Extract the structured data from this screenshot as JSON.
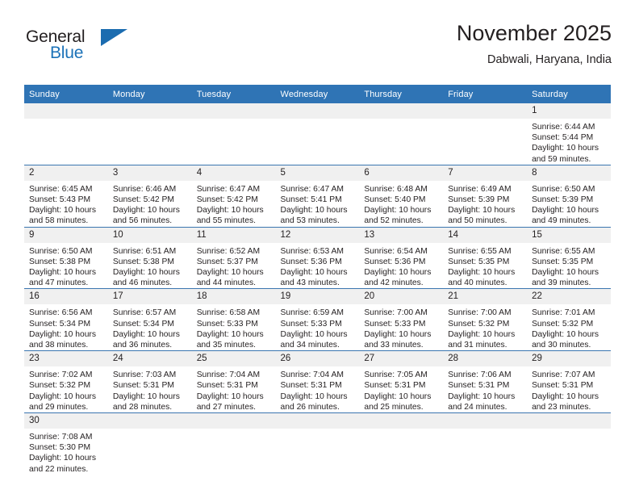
{
  "brand": {
    "word_one": "General",
    "word_two": "Blue",
    "flag_icon": "triangle-flag-icon",
    "accent_color": "#1b6cb0"
  },
  "header": {
    "title": "November 2025",
    "subtitle": "Dabwali, Haryana, India"
  },
  "theme": {
    "header_bg": "#2f74b5",
    "daynum_bg": "#f0f0f0",
    "row_divider": "#3b76b0",
    "text": "#231f20"
  },
  "weekday_headers": [
    "Sunday",
    "Monday",
    "Tuesday",
    "Wednesday",
    "Thursday",
    "Friday",
    "Saturday"
  ],
  "weeks": [
    [
      {
        "day": "",
        "blank": true
      },
      {
        "day": "",
        "blank": true
      },
      {
        "day": "",
        "blank": true
      },
      {
        "day": "",
        "blank": true
      },
      {
        "day": "",
        "blank": true
      },
      {
        "day": "",
        "blank": true
      },
      {
        "day": "1",
        "sunrise": "Sunrise: 6:44 AM",
        "sunset": "Sunset: 5:44 PM",
        "daylight_1": "Daylight: 10 hours",
        "daylight_2": "and 59 minutes."
      }
    ],
    [
      {
        "day": "2",
        "sunrise": "Sunrise: 6:45 AM",
        "sunset": "Sunset: 5:43 PM",
        "daylight_1": "Daylight: 10 hours",
        "daylight_2": "and 58 minutes."
      },
      {
        "day": "3",
        "sunrise": "Sunrise: 6:46 AM",
        "sunset": "Sunset: 5:42 PM",
        "daylight_1": "Daylight: 10 hours",
        "daylight_2": "and 56 minutes."
      },
      {
        "day": "4",
        "sunrise": "Sunrise: 6:47 AM",
        "sunset": "Sunset: 5:42 PM",
        "daylight_1": "Daylight: 10 hours",
        "daylight_2": "and 55 minutes."
      },
      {
        "day": "5",
        "sunrise": "Sunrise: 6:47 AM",
        "sunset": "Sunset: 5:41 PM",
        "daylight_1": "Daylight: 10 hours",
        "daylight_2": "and 53 minutes."
      },
      {
        "day": "6",
        "sunrise": "Sunrise: 6:48 AM",
        "sunset": "Sunset: 5:40 PM",
        "daylight_1": "Daylight: 10 hours",
        "daylight_2": "and 52 minutes."
      },
      {
        "day": "7",
        "sunrise": "Sunrise: 6:49 AM",
        "sunset": "Sunset: 5:39 PM",
        "daylight_1": "Daylight: 10 hours",
        "daylight_2": "and 50 minutes."
      },
      {
        "day": "8",
        "sunrise": "Sunrise: 6:50 AM",
        "sunset": "Sunset: 5:39 PM",
        "daylight_1": "Daylight: 10 hours",
        "daylight_2": "and 49 minutes."
      }
    ],
    [
      {
        "day": "9",
        "sunrise": "Sunrise: 6:50 AM",
        "sunset": "Sunset: 5:38 PM",
        "daylight_1": "Daylight: 10 hours",
        "daylight_2": "and 47 minutes."
      },
      {
        "day": "10",
        "sunrise": "Sunrise: 6:51 AM",
        "sunset": "Sunset: 5:38 PM",
        "daylight_1": "Daylight: 10 hours",
        "daylight_2": "and 46 minutes."
      },
      {
        "day": "11",
        "sunrise": "Sunrise: 6:52 AM",
        "sunset": "Sunset: 5:37 PM",
        "daylight_1": "Daylight: 10 hours",
        "daylight_2": "and 44 minutes."
      },
      {
        "day": "12",
        "sunrise": "Sunrise: 6:53 AM",
        "sunset": "Sunset: 5:36 PM",
        "daylight_1": "Daylight: 10 hours",
        "daylight_2": "and 43 minutes."
      },
      {
        "day": "13",
        "sunrise": "Sunrise: 6:54 AM",
        "sunset": "Sunset: 5:36 PM",
        "daylight_1": "Daylight: 10 hours",
        "daylight_2": "and 42 minutes."
      },
      {
        "day": "14",
        "sunrise": "Sunrise: 6:55 AM",
        "sunset": "Sunset: 5:35 PM",
        "daylight_1": "Daylight: 10 hours",
        "daylight_2": "and 40 minutes."
      },
      {
        "day": "15",
        "sunrise": "Sunrise: 6:55 AM",
        "sunset": "Sunset: 5:35 PM",
        "daylight_1": "Daylight: 10 hours",
        "daylight_2": "and 39 minutes."
      }
    ],
    [
      {
        "day": "16",
        "sunrise": "Sunrise: 6:56 AM",
        "sunset": "Sunset: 5:34 PM",
        "daylight_1": "Daylight: 10 hours",
        "daylight_2": "and 38 minutes."
      },
      {
        "day": "17",
        "sunrise": "Sunrise: 6:57 AM",
        "sunset": "Sunset: 5:34 PM",
        "daylight_1": "Daylight: 10 hours",
        "daylight_2": "and 36 minutes."
      },
      {
        "day": "18",
        "sunrise": "Sunrise: 6:58 AM",
        "sunset": "Sunset: 5:33 PM",
        "daylight_1": "Daylight: 10 hours",
        "daylight_2": "and 35 minutes."
      },
      {
        "day": "19",
        "sunrise": "Sunrise: 6:59 AM",
        "sunset": "Sunset: 5:33 PM",
        "daylight_1": "Daylight: 10 hours",
        "daylight_2": "and 34 minutes."
      },
      {
        "day": "20",
        "sunrise": "Sunrise: 7:00 AM",
        "sunset": "Sunset: 5:33 PM",
        "daylight_1": "Daylight: 10 hours",
        "daylight_2": "and 33 minutes."
      },
      {
        "day": "21",
        "sunrise": "Sunrise: 7:00 AM",
        "sunset": "Sunset: 5:32 PM",
        "daylight_1": "Daylight: 10 hours",
        "daylight_2": "and 31 minutes."
      },
      {
        "day": "22",
        "sunrise": "Sunrise: 7:01 AM",
        "sunset": "Sunset: 5:32 PM",
        "daylight_1": "Daylight: 10 hours",
        "daylight_2": "and 30 minutes."
      }
    ],
    [
      {
        "day": "23",
        "sunrise": "Sunrise: 7:02 AM",
        "sunset": "Sunset: 5:32 PM",
        "daylight_1": "Daylight: 10 hours",
        "daylight_2": "and 29 minutes."
      },
      {
        "day": "24",
        "sunrise": "Sunrise: 7:03 AM",
        "sunset": "Sunset: 5:31 PM",
        "daylight_1": "Daylight: 10 hours",
        "daylight_2": "and 28 minutes."
      },
      {
        "day": "25",
        "sunrise": "Sunrise: 7:04 AM",
        "sunset": "Sunset: 5:31 PM",
        "daylight_1": "Daylight: 10 hours",
        "daylight_2": "and 27 minutes."
      },
      {
        "day": "26",
        "sunrise": "Sunrise: 7:04 AM",
        "sunset": "Sunset: 5:31 PM",
        "daylight_1": "Daylight: 10 hours",
        "daylight_2": "and 26 minutes."
      },
      {
        "day": "27",
        "sunrise": "Sunrise: 7:05 AM",
        "sunset": "Sunset: 5:31 PM",
        "daylight_1": "Daylight: 10 hours",
        "daylight_2": "and 25 minutes."
      },
      {
        "day": "28",
        "sunrise": "Sunrise: 7:06 AM",
        "sunset": "Sunset: 5:31 PM",
        "daylight_1": "Daylight: 10 hours",
        "daylight_2": "and 24 minutes."
      },
      {
        "day": "29",
        "sunrise": "Sunrise: 7:07 AM",
        "sunset": "Sunset: 5:31 PM",
        "daylight_1": "Daylight: 10 hours",
        "daylight_2": "and 23 minutes."
      }
    ],
    [
      {
        "day": "30",
        "sunrise": "Sunrise: 7:08 AM",
        "sunset": "Sunset: 5:30 PM",
        "daylight_1": "Daylight: 10 hours",
        "daylight_2": "and 22 minutes."
      },
      {
        "day": "",
        "blank": true
      },
      {
        "day": "",
        "blank": true
      },
      {
        "day": "",
        "blank": true
      },
      {
        "day": "",
        "blank": true
      },
      {
        "day": "",
        "blank": true
      },
      {
        "day": "",
        "blank": true
      }
    ]
  ]
}
